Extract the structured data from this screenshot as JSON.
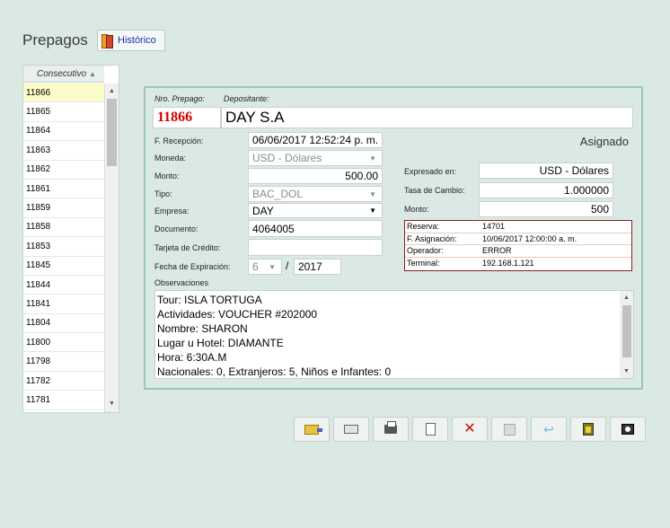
{
  "header": {
    "title": "Prepagos",
    "historico_label": "Histórico"
  },
  "list": {
    "column_header": "Consecutivo",
    "rows": [
      "11866",
      "11865",
      "11864",
      "11863",
      "11862",
      "11861",
      "11859",
      "11858",
      "11853",
      "11845",
      "11844",
      "11841",
      "11804",
      "11800",
      "11798",
      "11782",
      "11781"
    ],
    "selected": "11866"
  },
  "form": {
    "nro_prepago_label": "Nro. Prepago:",
    "nro_prepago": "11866",
    "depositante_label": "Depositante:",
    "depositante": "DAY S.A",
    "status": "Asignado",
    "recepcion_label": "F. Recepción:",
    "recepcion": "06/06/2017 12:52:24 p. m.",
    "moneda_label": "Moneda:",
    "moneda": "USD - Dólares",
    "monto_label": "Monto:",
    "monto": "500.00",
    "tipo_label": "Tipo:",
    "tipo": "BAC_DOL",
    "empresa_label": "Empresa:",
    "empresa": "DAY",
    "documento_label": "Documento:",
    "documento": "4064005",
    "tarjeta_label": "Tarjeta de Crédito:",
    "tarjeta": "",
    "expiracion_label": "Fecha de Expiración:",
    "exp_month": "6",
    "exp_year": "2017",
    "expresado_label": "Expresado en:",
    "expresado": "USD - Dólares",
    "tasa_label": "Tasa de Cambio:",
    "tasa": "1.000000",
    "monto2_label": "Monto:",
    "monto2": "500",
    "observaciones_label": "Observaciones",
    "observaciones": [
      "Tour: ISLA TORTUGA",
      "Actividades: VOUCHER #202000",
      "Nombre: SHARON",
      "Lugar u Hotel: DIAMANTE",
      "Hora: 6:30A.M",
      "Nacionales: 0, Extranjeros: 5, Niños e Infantes: 0"
    ]
  },
  "info": {
    "reserva_label": "Reserva:",
    "reserva": "14701",
    "asignacion_label": "F. Asignación:",
    "asignacion": "10/06/2017 12:00:00 a. m.",
    "operador_label": "Operador:",
    "operador": "ERROR",
    "terminal_label": "Terminal:",
    "terminal": "192.168.1.121"
  },
  "toolbar": {
    "icons": [
      "open-folder-icon",
      "keyboard-icon",
      "print-icon",
      "new-document-icon",
      "delete-icon",
      "save-icon",
      "undo-icon",
      "export-icon",
      "settings-icon"
    ]
  }
}
